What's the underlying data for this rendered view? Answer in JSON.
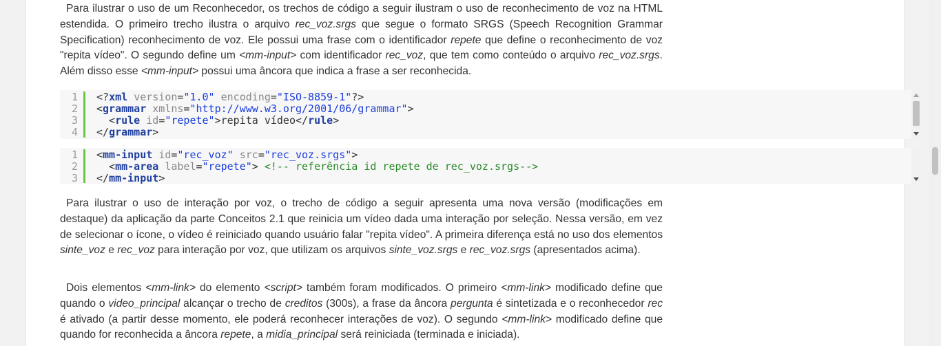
{
  "paragraphs": {
    "p1": [
      {
        "t": "Para ilustrar o uso de um Reconhecedor, os trechos de código a seguir ilustram o uso de reconhecimento de voz na HTML estendida. O primeiro trecho ilustra o arquivo "
      },
      {
        "t": "rec_voz.srgs",
        "i": true
      },
      {
        "t": " que segue o formato SRGS (Speech Recognition Grammar Specification) reconhecimento de voz. Ele possui uma frase com o identificador "
      },
      {
        "t": "repete",
        "i": true
      },
      {
        "t": " que define o reconhecimento de voz \"repita vídeo\". O segundo define um "
      },
      {
        "t": "<mm-input>",
        "i": true
      },
      {
        "t": " com identificador "
      },
      {
        "t": "rec_voz",
        "i": true
      },
      {
        "t": ", que tem como conteúdo o arquivo "
      },
      {
        "t": "rec_voz.srgs",
        "i": true
      },
      {
        "t": ". Além disso esse "
      },
      {
        "t": "<mm-input>",
        "i": true
      },
      {
        "t": " possui uma âncora que indica a frase a ser reconhecida."
      }
    ],
    "p2": [
      {
        "t": "Para ilustrar o uso de interação por voz, o trecho de código a seguir apresenta uma nova versão (modificações em destaque) da aplicação da parte Conceitos 2.1 que reinicia um vídeo dada uma interação por seleção. Nessa versão, em vez de selecionar o ícone, o vídeo é reiniciado quando usuário falar \"repita vídeo\". A primeira diferença está no uso dos elementos "
      },
      {
        "t": "sinte_voz",
        "i": true
      },
      {
        "t": " e "
      },
      {
        "t": "rec_voz",
        "i": true
      },
      {
        "t": " para interação por voz, que utilizam os arquivos "
      },
      {
        "t": "sinte_voz.srgs",
        "i": true
      },
      {
        "t": " e "
      },
      {
        "t": "rec_voz.srgs",
        "i": true
      },
      {
        "t": " (apresentados acima)."
      }
    ],
    "p3": [
      {
        "t": "Dois elementos "
      },
      {
        "t": "<mm-link>",
        "i": true
      },
      {
        "t": " do elemento "
      },
      {
        "t": "<script>",
        "i": true
      },
      {
        "t": " também foram modificados. O primeiro "
      },
      {
        "t": "<mm-link>",
        "i": true
      },
      {
        "t": " modificado define que quando o "
      },
      {
        "t": "video_principal",
        "i": true
      },
      {
        "t": " alcançar o trecho de "
      },
      {
        "t": "creditos",
        "i": true
      },
      {
        "t": " (300s), a frase da âncora "
      },
      {
        "t": "pergunta",
        "i": true
      },
      {
        "t": " é sintetizada e o reconhecedor "
      },
      {
        "t": "rec",
        "i": true
      },
      {
        "t": " é ativado (a partir desse momento, ele poderá reconhecer interações de voz). O segundo "
      },
      {
        "t": "<mm-link>",
        "i": true
      },
      {
        "t": " modificado define que quando for reconhecida a âncora "
      },
      {
        "t": "repete",
        "i": true
      },
      {
        "t": ", a "
      },
      {
        "t": "midia_principal",
        "i": true
      },
      {
        "t": " será reiniciada (terminada e iniciada)."
      }
    ]
  },
  "code_blocks": [
    {
      "lines": [
        {
          "n": "1",
          "tokens": [
            [
              "tx",
              "<?"
            ],
            [
              "tg",
              "xml"
            ],
            [
              "tx",
              " "
            ],
            [
              "an",
              "version"
            ],
            [
              "tx",
              "="
            ],
            [
              "av",
              "\"1.0\""
            ],
            [
              "tx",
              " "
            ],
            [
              "an",
              "encoding"
            ],
            [
              "tx",
              "="
            ],
            [
              "av",
              "\"ISO-8859-1\""
            ],
            [
              "tx",
              "?>"
            ]
          ]
        },
        {
          "n": "2",
          "tokens": [
            [
              "tx",
              "<"
            ],
            [
              "tg",
              "grammar"
            ],
            [
              "tx",
              " "
            ],
            [
              "an",
              "xmlns"
            ],
            [
              "tx",
              "="
            ],
            [
              "av",
              "\"http://www.w3.org/2001/06/grammar\""
            ],
            [
              "tx",
              ">"
            ]
          ]
        },
        {
          "n": "3",
          "tokens": [
            [
              "tx",
              "  <"
            ],
            [
              "tg",
              "rule"
            ],
            [
              "tx",
              " "
            ],
            [
              "an",
              "id"
            ],
            [
              "tx",
              "="
            ],
            [
              "av",
              "\"repete\""
            ],
            [
              "tx",
              ">repita vídeo</"
            ],
            [
              "tg",
              "rule"
            ],
            [
              "tx",
              ">"
            ]
          ]
        },
        {
          "n": "4",
          "tokens": [
            [
              "tx",
              "</"
            ],
            [
              "tg",
              "grammar"
            ],
            [
              "tx",
              ">"
            ]
          ]
        }
      ]
    },
    {
      "lines": [
        {
          "n": "1",
          "tokens": [
            [
              "tx",
              "<"
            ],
            [
              "tg",
              "mm-input"
            ],
            [
              "tx",
              " "
            ],
            [
              "an",
              "id"
            ],
            [
              "tx",
              "="
            ],
            [
              "av",
              "\"rec_voz\""
            ],
            [
              "tx",
              " "
            ],
            [
              "an",
              "src"
            ],
            [
              "tx",
              "="
            ],
            [
              "av",
              "\"rec_voz.srgs\""
            ],
            [
              "tx",
              ">"
            ]
          ]
        },
        {
          "n": "2",
          "tokens": [
            [
              "tx",
              "  <"
            ],
            [
              "tg",
              "mm-area"
            ],
            [
              "tx",
              " "
            ],
            [
              "an",
              "label"
            ],
            [
              "tx",
              "="
            ],
            [
              "av",
              "\"repete\""
            ],
            [
              "tx",
              "> "
            ],
            [
              "cm",
              "<!-- referência id repete de rec_voz.srgs-->"
            ]
          ]
        },
        {
          "n": "3",
          "tokens": [
            [
              "tx",
              "</"
            ],
            [
              "tg",
              "mm-input"
            ],
            [
              "tx",
              ">"
            ]
          ]
        }
      ]
    }
  ]
}
